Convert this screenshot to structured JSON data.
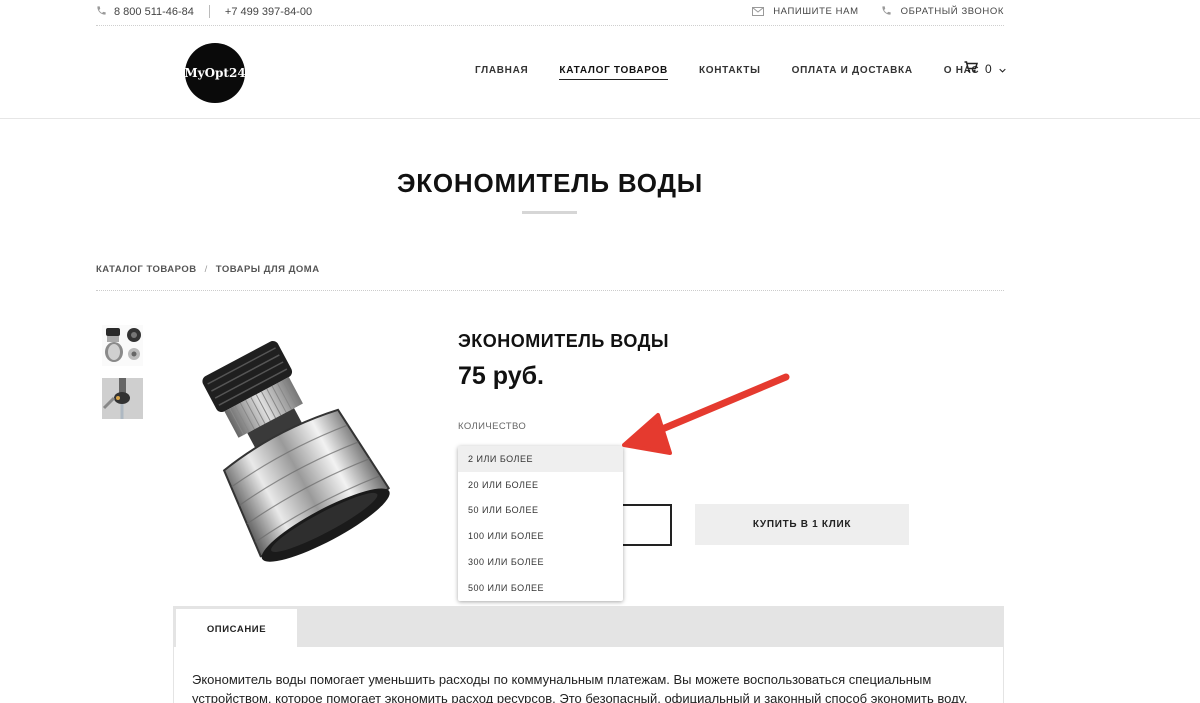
{
  "topbar": {
    "phone1": "8 800 511-46-84",
    "phone2": "+7 499 397-84-00",
    "write_us": "НАПИШИТЕ НАМ",
    "callback": "ОБРАТНЫЙ ЗВОНОК"
  },
  "header": {
    "logo_text": "MyOpt24",
    "nav": [
      "ГЛАВНАЯ",
      "КАТАЛОГ ТОВАРОВ",
      "КОНТАКТЫ",
      "ОПЛАТА И ДОСТАВКА",
      "О НАС"
    ],
    "active_nav": "КАТАЛОГ ТОВАРОВ",
    "cart_count": "0"
  },
  "page_title": "ЭКОНОМИТЕЛЬ ВОДЫ",
  "breadcrumb": [
    "КАТАЛОГ ТОВАРОВ",
    "/",
    "ТОВАРЫ ДЛЯ ДОМА"
  ],
  "product": {
    "name": "ЭКОНОМИТЕЛЬ ВОДЫ",
    "price": "75 руб.",
    "quantity_label": "КОЛИЧЕСТВО",
    "buy_one_click": "КУПИТЬ В 1 КЛИК"
  },
  "quantity_dropdown": {
    "selected": "2 ИЛИ БОЛЕЕ",
    "options": [
      "2 ИЛИ БОЛЕЕ",
      "20 ИЛИ БОЛЕЕ",
      "50 ИЛИ БОЛЕЕ",
      "100 ИЛИ БОЛЕЕ",
      "300 ИЛИ БОЛЕЕ",
      "500 ИЛИ БОЛЕЕ"
    ]
  },
  "tabs": {
    "description": "ОПИСАНИЕ"
  },
  "description_text": "Экономитель воды помогает уменьшить расходы по коммунальным платежам. Вы можете воспользоваться специальным устройством, которое помогает экономить расход ресурсов. Это безопасный, официальный и законный способ экономить воду.",
  "colors": {
    "annotation_arrow": "#e53a2f",
    "logo_bg": "#0a0a0a",
    "tab_bar": "#e4e4e4"
  }
}
